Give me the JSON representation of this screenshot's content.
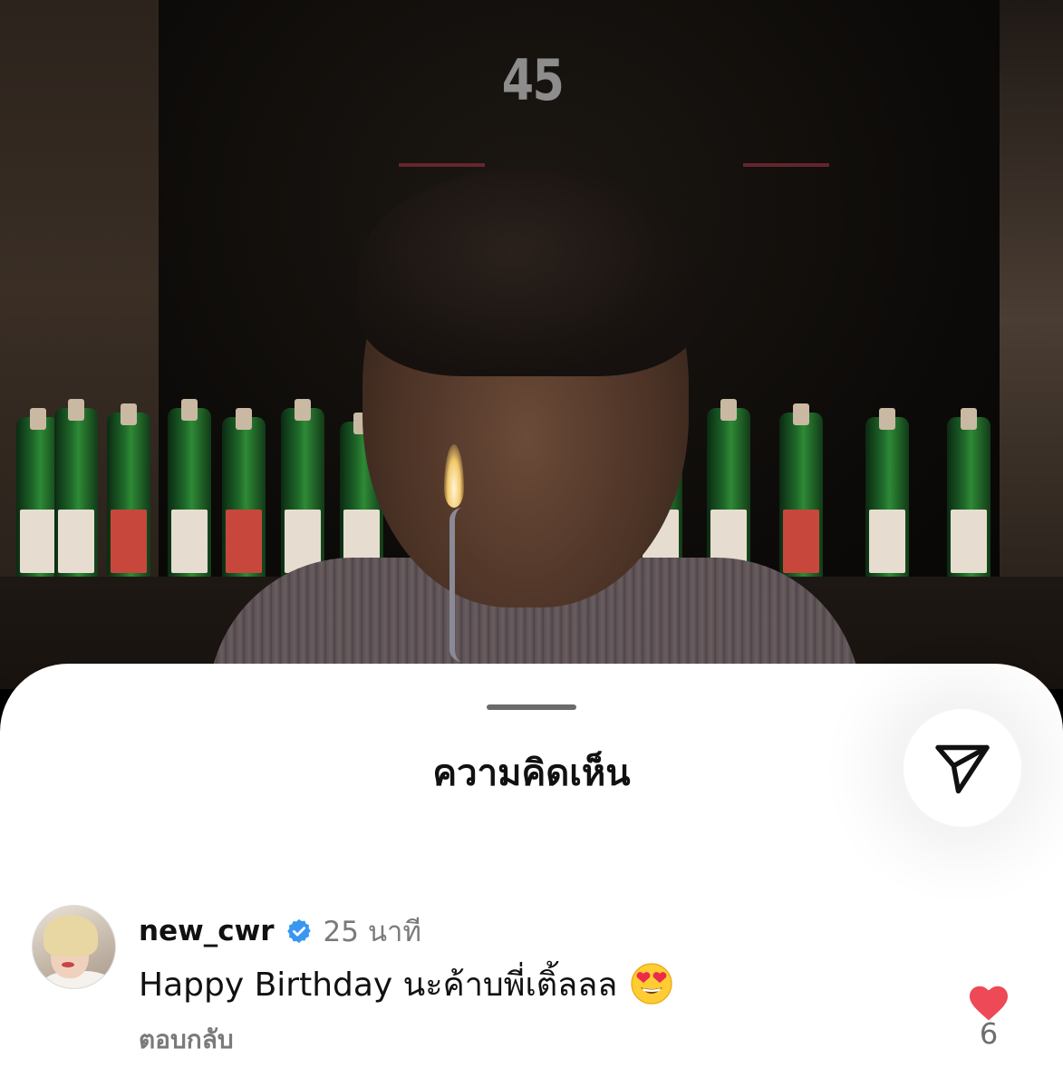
{
  "photo": {
    "counter": "45"
  },
  "sheet": {
    "title": "ความคิดเห็น"
  },
  "comment": {
    "username": "new_cwr",
    "verified": true,
    "time": "25 นาที",
    "text": "Happy Birthday นะค้าบพี่เติ้ลลล",
    "emoji": "heart-eyes-emoji",
    "reply_label": "ตอบกลับ",
    "liked": true,
    "like_count": "6"
  },
  "colors": {
    "like": "#ed4956",
    "verified": "#3897f0",
    "muted_text": "#7a7a7a"
  },
  "icons": {
    "share": "paper-plane-icon",
    "like": "heart-icon",
    "verified": "verified-badge-icon"
  }
}
